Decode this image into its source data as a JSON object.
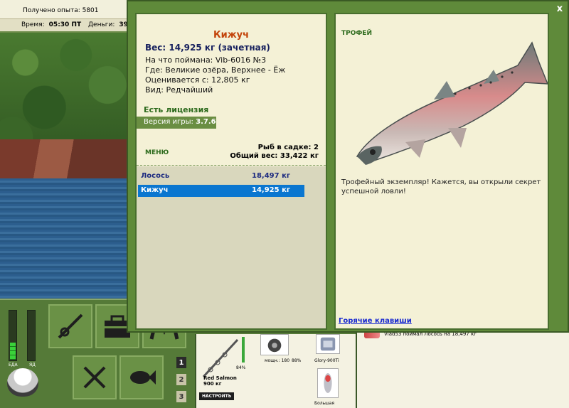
{
  "hud": {
    "xp_label": "Получено опыта: 5801",
    "time_label": "Время:",
    "time_value": "05:30 ПТ",
    "money_label": "Деньги:",
    "money_value": "39"
  },
  "meters": {
    "food_label": "ЕДА",
    "other_label": "ЯД",
    "food_fill": 0.35,
    "other_fill": 0.0
  },
  "slots": [
    "1",
    "2",
    "3"
  ],
  "tackle": {
    "rod_name": "Red Salmon",
    "rod_weight": "900 кг",
    "rod_pct": "84%",
    "setup_button": "НАСТРОИТЬ",
    "reel_power": "мощн.: 180",
    "reel_pct": "88%",
    "line_name": "Glory-900Ti",
    "lure_size": "Большая"
  },
  "chat": {
    "message": "Vlad53 поймал Лосось на 18,497 кг"
  },
  "modal": {
    "close_label": "x",
    "fish_name": "Кижуч",
    "weight_line": "Вес: 14,925 кг (зачетная)",
    "info": [
      "На что поймана: Vib-6016 №3",
      "Где: Великие озёра, Верхнее - Ёж",
      "Оценивается с: 12,805 кг",
      "Вид: Редчайший"
    ],
    "license": "Есть лицензия",
    "version_label": "Версия игры:",
    "version_value": "3.7.6",
    "menu": "МЕНЮ",
    "keep_count": "Рыб в садке: 2",
    "keep_weight": "Общий вес: 33,422 кг",
    "catch_list": [
      {
        "name": "Лосось",
        "weight": "18,497 кг",
        "selected": false
      },
      {
        "name": "Кижуч",
        "weight": "14,925 кг",
        "selected": true
      }
    ],
    "trophy_label": "ТРОФЕЙ",
    "trophy_text": "Трофейный экземпляр! Кажется, вы открыли секрет успешной ловли!",
    "hotkeys": "Горячие клавиши"
  },
  "colors": {
    "panel_green": "#5f8a3a",
    "title_orange": "#c3440a",
    "select_blue": "#0a76d0",
    "link_blue": "#1a2ad0"
  }
}
